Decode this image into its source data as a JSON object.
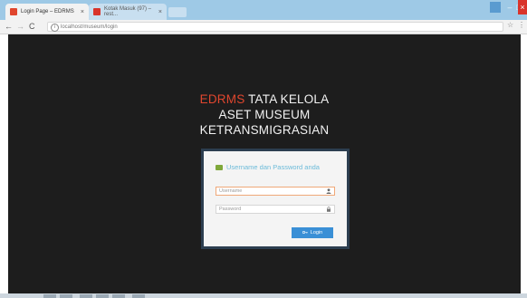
{
  "browser": {
    "tabs": [
      {
        "label": "Login Page – EDRMS",
        "close": "×",
        "favicon_color": "#e0462e"
      },
      {
        "label": "Kotak Masuk (97) – rest...",
        "close": "×",
        "favicon_color": "#d9342b"
      }
    ],
    "address": "localhost/museum/login",
    "nav": {
      "back": "←",
      "forward": "→",
      "reload": "C",
      "info": "i"
    },
    "window_controls": {
      "minimize": "–",
      "maximize": "□",
      "close": "×"
    }
  },
  "page": {
    "heading": {
      "brand": "EDRMS",
      "line1_rest": " TATA KELOLA",
      "line2": "ASET MUSEUM",
      "line3": "KETRANSMIGRASIAN"
    },
    "login_panel": {
      "title": "Username dan Password anda",
      "username_placeholder": "Username",
      "password_placeholder": "Password",
      "button_label": "Login"
    }
  },
  "colors": {
    "page_background": "#1d1d1d",
    "brand": "#e0462e",
    "accent": "#3a8fd6",
    "title_text": "#6cbbd9",
    "panel_border": "#2c3e50"
  },
  "icons": {
    "username_field": "user-icon",
    "password_field": "lock-icon",
    "login_button": "key-icon",
    "panel_title": "id-card-icon"
  }
}
